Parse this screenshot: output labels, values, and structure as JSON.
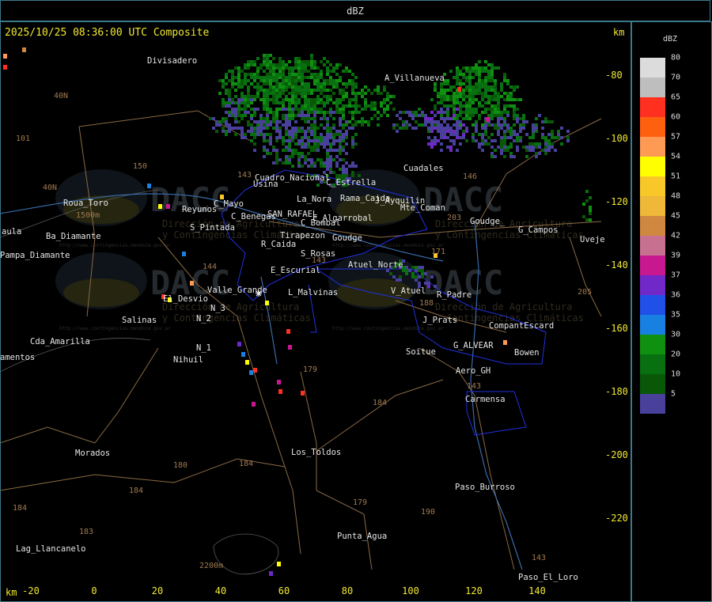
{
  "title": "dBZ",
  "header": "2025/10/25 08:36:00 UTC Composite",
  "axis_unit": "km",
  "x_ticks": [
    "-20",
    "0",
    "20",
    "40",
    "60",
    "80",
    "100",
    "120",
    "140"
  ],
  "y_ticks": [
    "-80",
    "-100",
    "-120",
    "-140",
    "-160",
    "-180",
    "-200",
    "-220"
  ],
  "legend": {
    "title": "dBZ",
    "levels": [
      {
        "label": "80",
        "color": "#dcdcdc"
      },
      {
        "label": "70",
        "color": "#bebebe"
      },
      {
        "label": "65",
        "color": "#ff3020"
      },
      {
        "label": "60",
        "color": "#ff6010"
      },
      {
        "label": "57",
        "color": "#ff9a55"
      },
      {
        "label": "54",
        "color": "#ffff00"
      },
      {
        "label": "51",
        "color": "#f8c828"
      },
      {
        "label": "48",
        "color": "#f0b838"
      },
      {
        "label": "45",
        "color": "#d08840"
      },
      {
        "label": "42",
        "color": "#c87090"
      },
      {
        "label": "39",
        "color": "#c81890"
      },
      {
        "label": "37",
        "color": "#7028c8"
      },
      {
        "label": "36",
        "color": "#2050e8"
      },
      {
        "label": "35",
        "color": "#1880e0"
      },
      {
        "label": "30",
        "color": "#109010"
      },
      {
        "label": "20",
        "color": "#087010"
      },
      {
        "label": "10",
        "color": "#085808"
      },
      {
        "label": "5",
        "color": "#48409a"
      }
    ]
  },
  "places": [
    {
      "name": "Divisadero",
      "x": 186,
      "y": 80
    },
    {
      "name": "A_Villanueva",
      "x": 486,
      "y": 102
    },
    {
      "name": "Cuadales",
      "x": 510,
      "y": 216
    },
    {
      "name": "Usina",
      "x": 320,
      "y": 236
    },
    {
      "name": "C_Estrella",
      "x": 412,
      "y": 234
    },
    {
      "name": "Rama_Caida",
      "x": 430,
      "y": 254
    },
    {
      "name": "Cuadro_Nacional",
      "x": 322,
      "y": 228
    },
    {
      "name": "La_Nora",
      "x": 375,
      "y": 255
    },
    {
      "name": "J_Ayquilin",
      "x": 474,
      "y": 257
    },
    {
      "name": "Mte_Coman",
      "x": 506,
      "y": 266
    },
    {
      "name": "Reyunos",
      "x": 230,
      "y": 268
    },
    {
      "name": "C_Mayo",
      "x": 270,
      "y": 261
    },
    {
      "name": "C_Benegas",
      "x": 292,
      "y": 277
    },
    {
      "name": "SAN_RAFAEL",
      "x": 338,
      "y": 274
    },
    {
      "name": "E_Algarrobal",
      "x": 395,
      "y": 279
    },
    {
      "name": "Goudge_",
      "x": 594,
      "y": 283
    },
    {
      "name": "G_Campos",
      "x": 655,
      "y": 294
    },
    {
      "name": "C_Bombal",
      "x": 380,
      "y": 285
    },
    {
      "name": "Roua_Toro",
      "x": 80,
      "y": 260
    },
    {
      "name": "aula",
      "x": 2,
      "y": 296
    },
    {
      "name": "Ba_Diamante",
      "x": 58,
      "y": 302
    },
    {
      "name": "Pampa_Diamante",
      "x": 0,
      "y": 326
    },
    {
      "name": "S_Pintada",
      "x": 240,
      "y": 291
    },
    {
      "name": "Tirapezon",
      "x": 354,
      "y": 301
    },
    {
      "name": "Goudge",
      "x": 420,
      "y": 304
    },
    {
      "name": "R_Caida",
      "x": 330,
      "y": 312
    },
    {
      "name": "S_Rosas",
      "x": 380,
      "y": 324
    },
    {
      "name": "Uveje",
      "x": 733,
      "y": 306
    },
    {
      "name": "Atuel_Norte",
      "x": 440,
      "y": 338
    },
    {
      "name": "E_Escurial",
      "x": 342,
      "y": 345
    },
    {
      "name": "Valle_Grande",
      "x": 262,
      "y": 370
    },
    {
      "name": "L_Malvinas",
      "x": 364,
      "y": 373
    },
    {
      "name": "V_Atuel",
      "x": 494,
      "y": 371
    },
    {
      "name": "R_Padre",
      "x": 552,
      "y": 376
    },
    {
      "name": "El_Desvio",
      "x": 206,
      "y": 381
    },
    {
      "name": "N_3",
      "x": 266,
      "y": 393
    },
    {
      "name": "N_2",
      "x": 248,
      "y": 406
    },
    {
      "name": "Salinas",
      "x": 154,
      "y": 408
    },
    {
      "name": "J_Prats",
      "x": 534,
      "y": 408
    },
    {
      "name": "CompantEscard",
      "x": 618,
      "y": 415
    },
    {
      "name": "Cda_Amarilla",
      "x": 38,
      "y": 435
    },
    {
      "name": "G_ALVEAR",
      "x": 573,
      "y": 440
    },
    {
      "name": "N_1",
      "x": 248,
      "y": 443
    },
    {
      "name": "Soitue",
      "x": 513,
      "y": 448
    },
    {
      "name": "Bowen",
      "x": 650,
      "y": 449
    },
    {
      "name": "amentos",
      "x": 0,
      "y": 455
    },
    {
      "name": "Nihuil",
      "x": 219,
      "y": 458
    },
    {
      "name": "Aero_GH",
      "x": 576,
      "y": 472
    },
    {
      "name": "Carmensa",
      "x": 588,
      "y": 508
    },
    {
      "name": "Morados",
      "x": 95,
      "y": 576
    },
    {
      "name": "Los_Toldos",
      "x": 368,
      "y": 575
    },
    {
      "name": "Paso_Burroso",
      "x": 575,
      "y": 619
    },
    {
      "name": "Punta_Agua",
      "x": 426,
      "y": 681
    },
    {
      "name": "Lag_Llancanelo",
      "x": 20,
      "y": 697
    },
    {
      "name": "Paso_El_Loro",
      "x": 655,
      "y": 733
    }
  ],
  "road_numbers": [
    {
      "name": "40N",
      "x": 68,
      "y": 124
    },
    {
      "name": "101",
      "x": 20,
      "y": 178
    },
    {
      "name": "40N",
      "x": 54,
      "y": 240
    },
    {
      "name": "150",
      "x": 168,
      "y": 213
    },
    {
      "name": "143",
      "x": 300,
      "y": 224
    },
    {
      "name": "144",
      "x": 256,
      "y": 340
    },
    {
      "name": "143",
      "x": 394,
      "y": 332
    },
    {
      "name": "146",
      "x": 585,
      "y": 226
    },
    {
      "name": "203",
      "x": 565,
      "y": 278
    },
    {
      "name": "171",
      "x": 545,
      "y": 321
    },
    {
      "name": "205",
      "x": 730,
      "y": 372
    },
    {
      "name": "188",
      "x": 530,
      "y": 386
    },
    {
      "name": "179",
      "x": 383,
      "y": 470
    },
    {
      "name": "184",
      "x": 471,
      "y": 512
    },
    {
      "name": "143",
      "x": 590,
      "y": 491
    },
    {
      "name": "180",
      "x": 219,
      "y": 591
    },
    {
      "name": "184",
      "x": 302,
      "y": 589
    },
    {
      "name": "184",
      "x": 163,
      "y": 623
    },
    {
      "name": "184",
      "x": 16,
      "y": 645
    },
    {
      "name": "179",
      "x": 446,
      "y": 638
    },
    {
      "name": "190",
      "x": 532,
      "y": 650
    },
    {
      "name": "183",
      "x": 100,
      "y": 675
    },
    {
      "name": "143",
      "x": 672,
      "y": 708
    },
    {
      "name": "1500m",
      "x": 96,
      "y": 275
    },
    {
      "name": "2200m",
      "x": 252,
      "y": 718
    }
  ],
  "watermark": {
    "brand": "DACC",
    "line1": "Dirección de Agricultura",
    "line2": "y Contingencias Climáticas",
    "url": "http://www.contingencias.mendoza.gov.ar"
  }
}
